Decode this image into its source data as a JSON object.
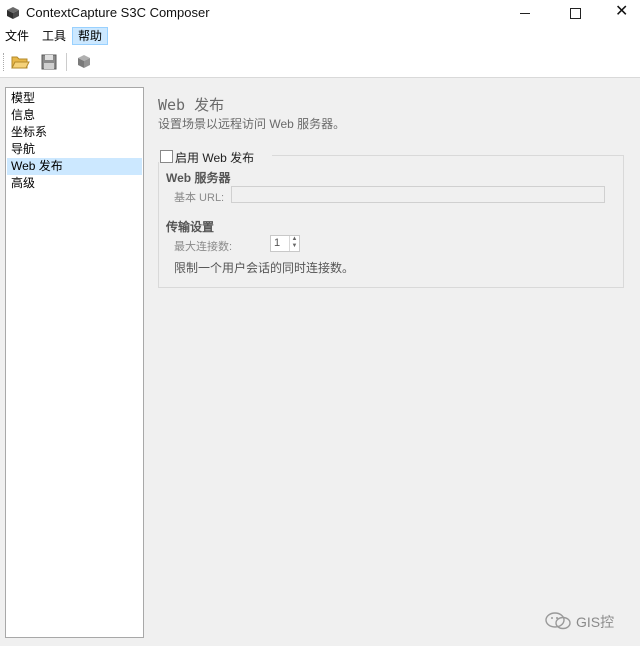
{
  "window": {
    "title": "ContextCapture S3C Composer",
    "minimize": "—",
    "maximize": "□",
    "close": "✕"
  },
  "menu": {
    "file": "文件",
    "tools": "工具",
    "help": "帮助"
  },
  "toolbar": {
    "icons": [
      "folder-open-icon",
      "save-icon",
      "publish-icon"
    ]
  },
  "sidebar": {
    "items": [
      {
        "label": "模型",
        "selected": false
      },
      {
        "label": "信息",
        "selected": false
      },
      {
        "label": "坐标系",
        "selected": false
      },
      {
        "label": "导航",
        "selected": false
      },
      {
        "label": "Web 发布",
        "selected": true
      },
      {
        "label": "高级",
        "selected": false
      }
    ]
  },
  "page": {
    "title": "Web 发布",
    "description": "设置场景以远程访问 Web 服务器。",
    "enable_label": "启用 Web 发布",
    "enable_checked": false,
    "server_section": "Web 服务器",
    "base_url_label": "基本 URL:",
    "base_url_value": "",
    "transfer_section": "传输设置",
    "max_conn_label": "最大连接数:",
    "max_conn_value": "1",
    "max_conn_hint": "限制一个用户会话的同时连接数。"
  },
  "watermark": {
    "text": "GIS控"
  },
  "colors": {
    "selection": "#cce8ff",
    "panel_bg": "#f0f0f0"
  }
}
